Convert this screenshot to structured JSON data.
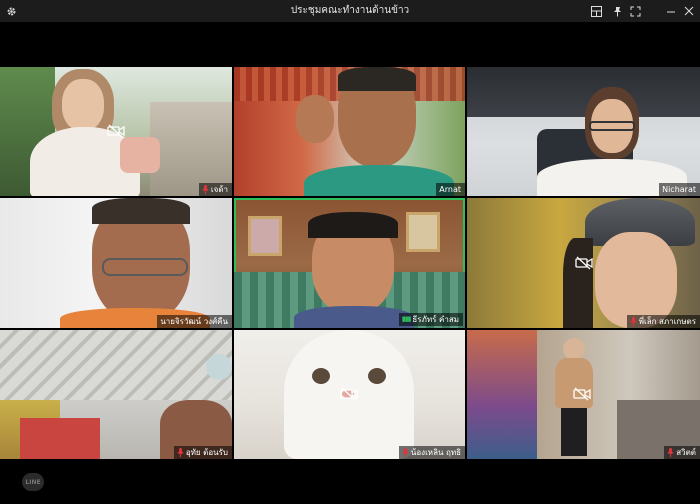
{
  "window": {
    "title": "ประชุมคณะทำงานด้านข้าว",
    "buttons": [
      "settings",
      "layout",
      "pin",
      "fullscreen",
      "minimize",
      "close"
    ]
  },
  "participants": [
    {
      "name": "เจด้า",
      "mic_muted": true,
      "camera_off": true
    },
    {
      "name": "Arnat",
      "mic_muted": false,
      "camera_off": false
    },
    {
      "name": "Nicharat",
      "mic_muted": false,
      "camera_off": false
    },
    {
      "name": "นายจิรวัฒน์ วงศ์คืน",
      "mic_muted": false,
      "camera_off": false
    },
    {
      "name": "ธีรภัทร์ คำสม",
      "mic_muted": false,
      "camera_off": false,
      "speaking": true
    },
    {
      "name": "พี่เล็ก สภาเกษตร",
      "mic_muted": true,
      "camera_off": true
    },
    {
      "name": "อุทัย ต้อนรับ",
      "mic_muted": true,
      "camera_off": false
    },
    {
      "name": "น้องเหลิน ฤทธิ",
      "mic_muted": true,
      "camera_off": true
    },
    {
      "name": "สวิตต์",
      "mic_muted": true,
      "camera_off": true
    }
  ],
  "branding": {
    "logo_text": "LINE"
  },
  "colors": {
    "speaking_border": "#2dbf5a",
    "mute_red": "#e0343b",
    "background": "#000000"
  }
}
